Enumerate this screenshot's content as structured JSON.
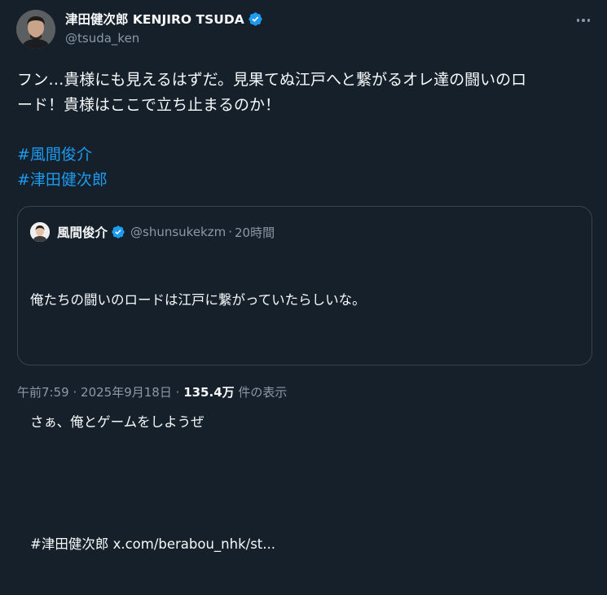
{
  "author": {
    "display_name": "津田健次郎 KENJIRO TSUDA",
    "handle": "@tsuda_ken"
  },
  "tweet": {
    "text": "フン…貴様にも見えるはずだ。見果てぬ江戸へと繋がるオレ達の闘いのロ\nード！貴様はここで立ち止まるのか！",
    "hashtags": [
      "#風間俊介",
      "#津田健次郎"
    ]
  },
  "quote": {
    "display_name": "風間俊介",
    "handle": "@shunsukekzm",
    "separator": "·",
    "time": "20時間",
    "line1": "俺たちの闘いのロードは江戸に繋がっていたらしいな。",
    "line2": "さぁ、俺とゲームをしようぜ",
    "hashtag": "#津田健次郎",
    "link": "x.com/berabou_nhk/st..."
  },
  "meta": {
    "time": "午前7:59",
    "sep1": "·",
    "date": "2025年9月18日",
    "sep2": "·",
    "views_count": "135.4万",
    "views_label": "件の表示"
  },
  "icons": {
    "verified": "verified-badge-icon",
    "more": "more-options-icon"
  },
  "colors": {
    "background": "#15202b",
    "link": "#1d9bf0",
    "secondary_text": "#8b98a5",
    "border": "#38444d",
    "verified": "#1d9bf0"
  }
}
